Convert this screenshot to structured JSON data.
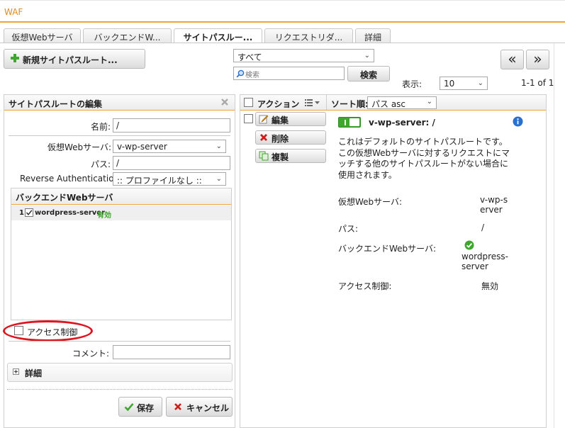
{
  "app": {
    "title": "WAF"
  },
  "tabs": [
    {
      "label": "仮想Webサーバ"
    },
    {
      "label": "バックエンドW..."
    },
    {
      "label": "サイトパスルー..."
    },
    {
      "label": "リクエストリダ..."
    },
    {
      "label": "詳細"
    }
  ],
  "toolbar": {
    "new_label": "新規サイトパスルート...",
    "filter_value": "すべて",
    "search_placeholder": "検索",
    "search_label": "検索",
    "show_label": "表示:",
    "page_size": "10",
    "first_glyph": "«",
    "next_glyph": "»",
    "range": "1-1 of 1"
  },
  "edit": {
    "title": "サイトパスルートの編集",
    "name_label": "名前:",
    "name_value": "/",
    "vs_label": "仮想Webサーバ:",
    "vs_value": "v-wp-server",
    "path_label": "パス:",
    "path_value": "/",
    "auth_label": "Reverse Authentication:",
    "auth_value": ":: プロファイルなし ::",
    "backend_title": "バックエンドWebサーバ",
    "backend_items": [
      {
        "index": "1",
        "name": "wordpress-server",
        "status": "有効"
      }
    ],
    "access_label": "アクセス制御",
    "comment_label": "コメント:",
    "comment_value": "",
    "details_label": "詳細",
    "save_label": "保存",
    "cancel_label": "キャンセル"
  },
  "list": {
    "action_label": "アクション",
    "sort_label": "ソート順:",
    "sort_value": "パス asc",
    "edit_label": "編集",
    "delete_label": "削除",
    "copy_label": "複製",
    "item": {
      "title": "v-wp-server: /",
      "description": "これはデフォルトのサイトパスルートです。この仮想Webサーバに対するリクエストにマッチする他のサイトパスルートがない場合に使用されます。",
      "vs_label": "仮想Webサーバ:",
      "vs_value": "v-wp-server",
      "path_label": "パス:",
      "path_value": "/",
      "backend_label": "バックエンドWebサーバ:",
      "backend_value": "wordpress-server",
      "access_label": "アクセス制御:",
      "access_value": "無効"
    }
  },
  "colors": {
    "accent": "#f0a33a",
    "highlight": "#e0141e",
    "ok": "#3fa72e",
    "info": "#2a6fcf"
  }
}
